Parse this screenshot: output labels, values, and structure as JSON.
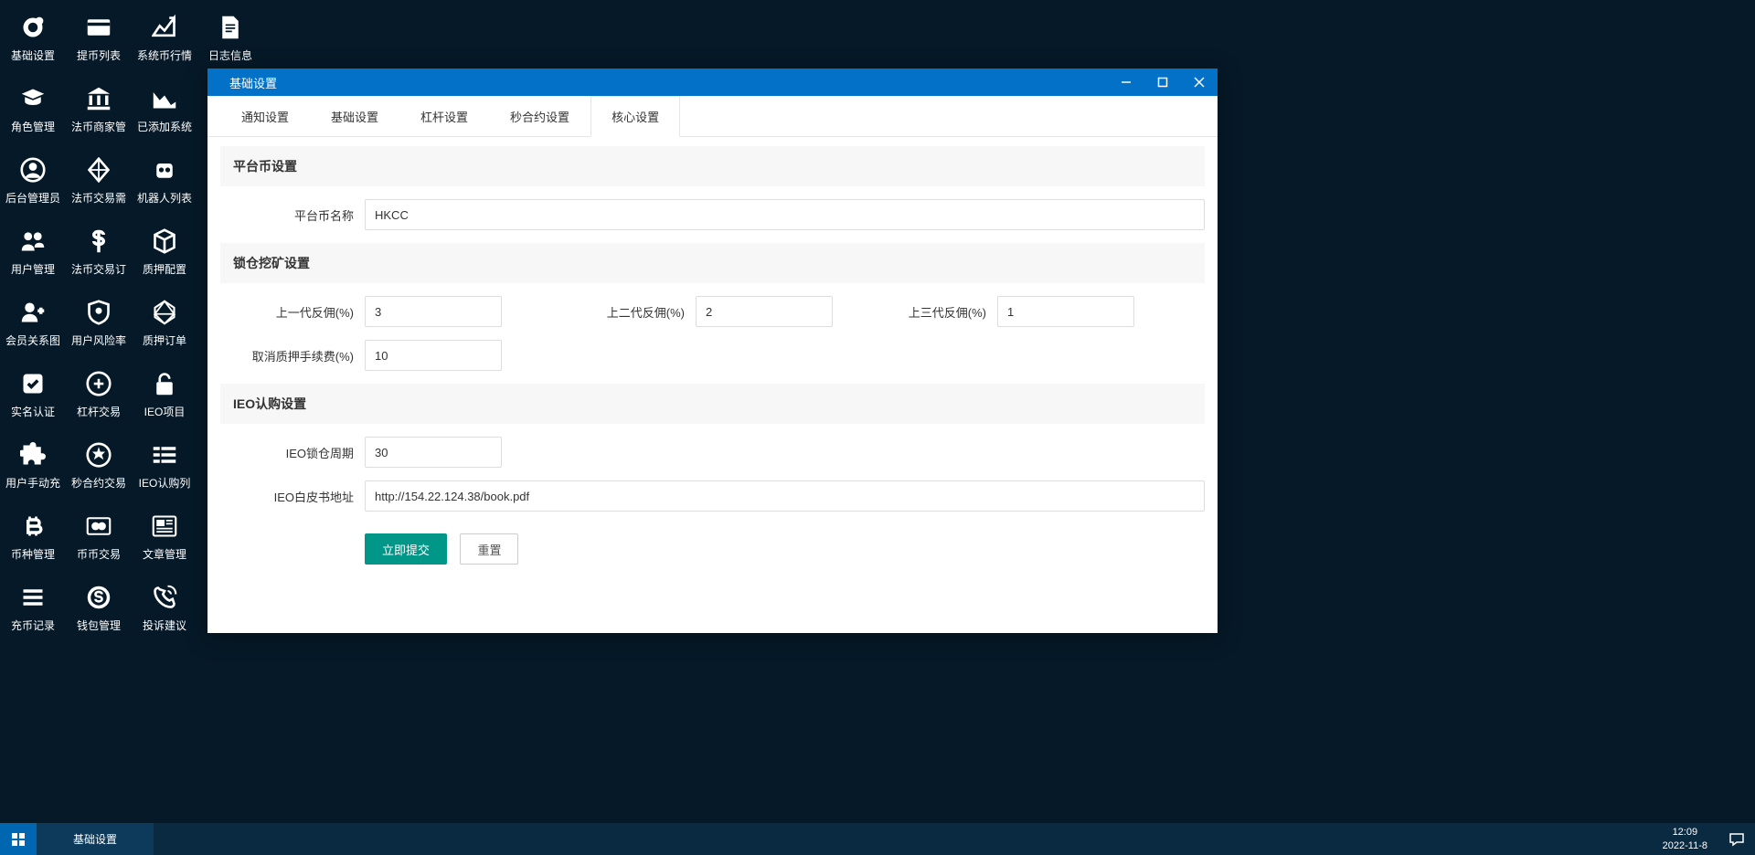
{
  "desktop_icons": [
    {
      "name": "basic-settings",
      "label": "基础设置",
      "icon": "gear"
    },
    {
      "name": "withdraw-list",
      "label": "提币列表",
      "icon": "card"
    },
    {
      "name": "system-coin-market",
      "label": "系统币行情",
      "icon": "chart-line"
    },
    {
      "name": "log-info",
      "label": "日志信息",
      "icon": "doc"
    },
    {
      "name": "role-mgmt",
      "label": "角色管理",
      "icon": "graduation"
    },
    {
      "name": "fiat-merchant-mgmt",
      "label": "法币商家管",
      "icon": "bank"
    },
    {
      "name": "added-system",
      "label": "已添加系统",
      "icon": "chart-area"
    },
    null,
    {
      "name": "backend-admin",
      "label": "后台管理员",
      "icon": "user-circle"
    },
    {
      "name": "fiat-trade-demand",
      "label": "法币交易需",
      "icon": "diamond"
    },
    {
      "name": "robot-list",
      "label": "机器人列表",
      "icon": "robot"
    },
    null,
    {
      "name": "user-mgmt",
      "label": "用户管理",
      "icon": "users"
    },
    {
      "name": "fiat-trade-order",
      "label": "法币交易订",
      "icon": "dollar"
    },
    {
      "name": "pledge-config",
      "label": "质押配置",
      "icon": "cube"
    },
    null,
    {
      "name": "member-diagram",
      "label": "会员关系图",
      "icon": "user-plus"
    },
    {
      "name": "user-risk-rate",
      "label": "用户风险率",
      "icon": "shield"
    },
    {
      "name": "pledge-order",
      "label": "质押订单",
      "icon": "polygon"
    },
    null,
    {
      "name": "realname-auth",
      "label": "实名认证",
      "icon": "check-square"
    },
    {
      "name": "leverage-trade",
      "label": "杠杆交易",
      "icon": "coin-stack"
    },
    {
      "name": "ieo-project",
      "label": "IEO项目",
      "icon": "lock-open"
    },
    null,
    {
      "name": "user-manual-topup",
      "label": "用户手动充",
      "icon": "puzzle"
    },
    {
      "name": "second-contract-trade",
      "label": "秒合约交易",
      "icon": "emblem"
    },
    {
      "name": "ieo-subscribe-list",
      "label": "IEO认购列",
      "icon": "list"
    },
    null,
    {
      "name": "coin-mgmt",
      "label": "币种管理",
      "icon": "bitcoin"
    },
    {
      "name": "coin-coin-trade",
      "label": "币币交易",
      "icon": "mastercard"
    },
    {
      "name": "article-mgmt",
      "label": "文章管理",
      "icon": "news"
    },
    null,
    {
      "name": "deposit-record",
      "label": "充币记录",
      "icon": "lines"
    },
    {
      "name": "wallet-mgmt",
      "label": "钱包管理",
      "icon": "skype"
    },
    {
      "name": "complaint-suggest",
      "label": "投诉建议",
      "icon": "phone"
    }
  ],
  "window": {
    "title": "基础设置",
    "tabs": [
      {
        "label": "通知设置",
        "active": false
      },
      {
        "label": "基础设置",
        "active": false
      },
      {
        "label": "杠杆设置",
        "active": false
      },
      {
        "label": "秒合约设置",
        "active": false
      },
      {
        "label": "核心设置",
        "active": true
      }
    ],
    "sections": {
      "platform": {
        "title": "平台币设置",
        "name_label": "平台币名称",
        "name_value": "HKCC"
      },
      "mining": {
        "title": "锁仓挖矿设置",
        "gen1_label": "上一代反佣(%)",
        "gen1_value": "3",
        "gen2_label": "上二代反佣(%)",
        "gen2_value": "2",
        "gen3_label": "上三代反佣(%)",
        "gen3_value": "1",
        "cancel_fee_label": "取消质押手续费(%)",
        "cancel_fee_value": "10"
      },
      "ieo": {
        "title": "IEO认购设置",
        "lock_label": "IEO锁仓周期",
        "lock_value": "30",
        "whitepaper_label": "IEO白皮书地址",
        "whitepaper_value": "http://154.22.124.38/book.pdf"
      }
    },
    "buttons": {
      "submit": "立即提交",
      "reset": "重置"
    }
  },
  "taskbar": {
    "active_item": "基础设置",
    "time": "12:09",
    "date": "2022-11-8"
  }
}
